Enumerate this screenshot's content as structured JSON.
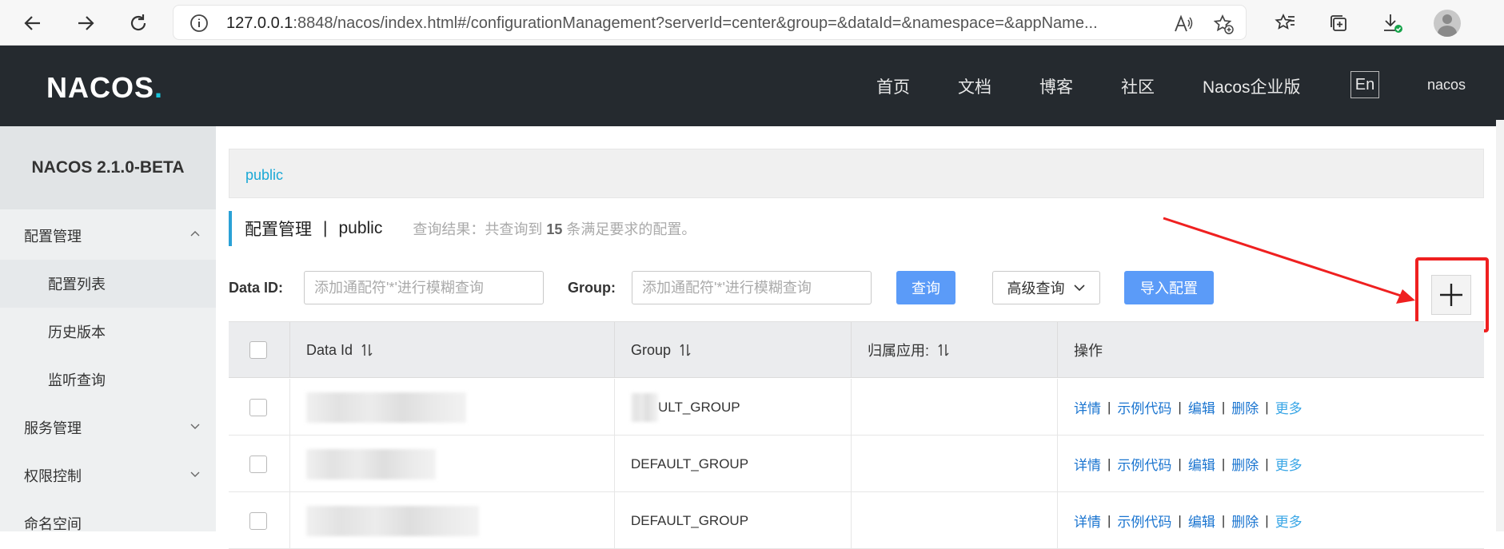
{
  "browser": {
    "url_host": "127.0.0.1",
    "url_rest": ":8848/nacos/index.html#/configurationManagement?serverId=center&group=&dataId=&namespace=&appName..."
  },
  "header": {
    "logo": "NACOS",
    "logo_dot": ".",
    "nav": [
      "首页",
      "文档",
      "博客",
      "社区",
      "Nacos企业版"
    ],
    "lang": "En",
    "user": "nacos"
  },
  "sidebar": {
    "version": "NACOS 2.1.0-BETA",
    "items": [
      {
        "label": "配置管理",
        "type": "group",
        "expanded": true
      },
      {
        "label": "配置列表",
        "type": "sub",
        "active": true
      },
      {
        "label": "历史版本",
        "type": "sub"
      },
      {
        "label": "监听查询",
        "type": "sub"
      },
      {
        "label": "服务管理",
        "type": "group",
        "expanded": false
      },
      {
        "label": "权限控制",
        "type": "group",
        "expanded": false
      },
      {
        "label": "命名空间",
        "type": "group"
      }
    ]
  },
  "main": {
    "namespace": "public",
    "title": "配置管理",
    "title_sep": "|",
    "title_ns": "public",
    "summary_prefix": "查询结果：共查询到",
    "summary_count": "15",
    "summary_suffix": "条满足要求的配置。",
    "filters": {
      "dataid_label": "Data ID:",
      "dataid_placeholder": "添加通配符'*'进行模糊查询",
      "group_label": "Group:",
      "group_placeholder": "添加通配符'*'进行模糊查询",
      "query_button": "查询",
      "advanced_button": "高级查询",
      "import_button": "导入配置"
    },
    "table": {
      "columns": [
        "Data Id",
        "Group",
        "归属应用:",
        "操作"
      ],
      "rows": [
        {
          "group": "ULT_GROUP"
        },
        {
          "group": "DEFAULT_GROUP"
        },
        {
          "group": "DEFAULT_GROUP"
        }
      ],
      "actions": [
        "详情",
        "示例代码",
        "编辑",
        "删除",
        "更多"
      ]
    }
  },
  "colors": {
    "header_bg": "#252a2f",
    "accent": "#19c3da",
    "primary_button": "#5b9bf8",
    "link": "#1b75d0",
    "annotation": "#ef2020"
  }
}
